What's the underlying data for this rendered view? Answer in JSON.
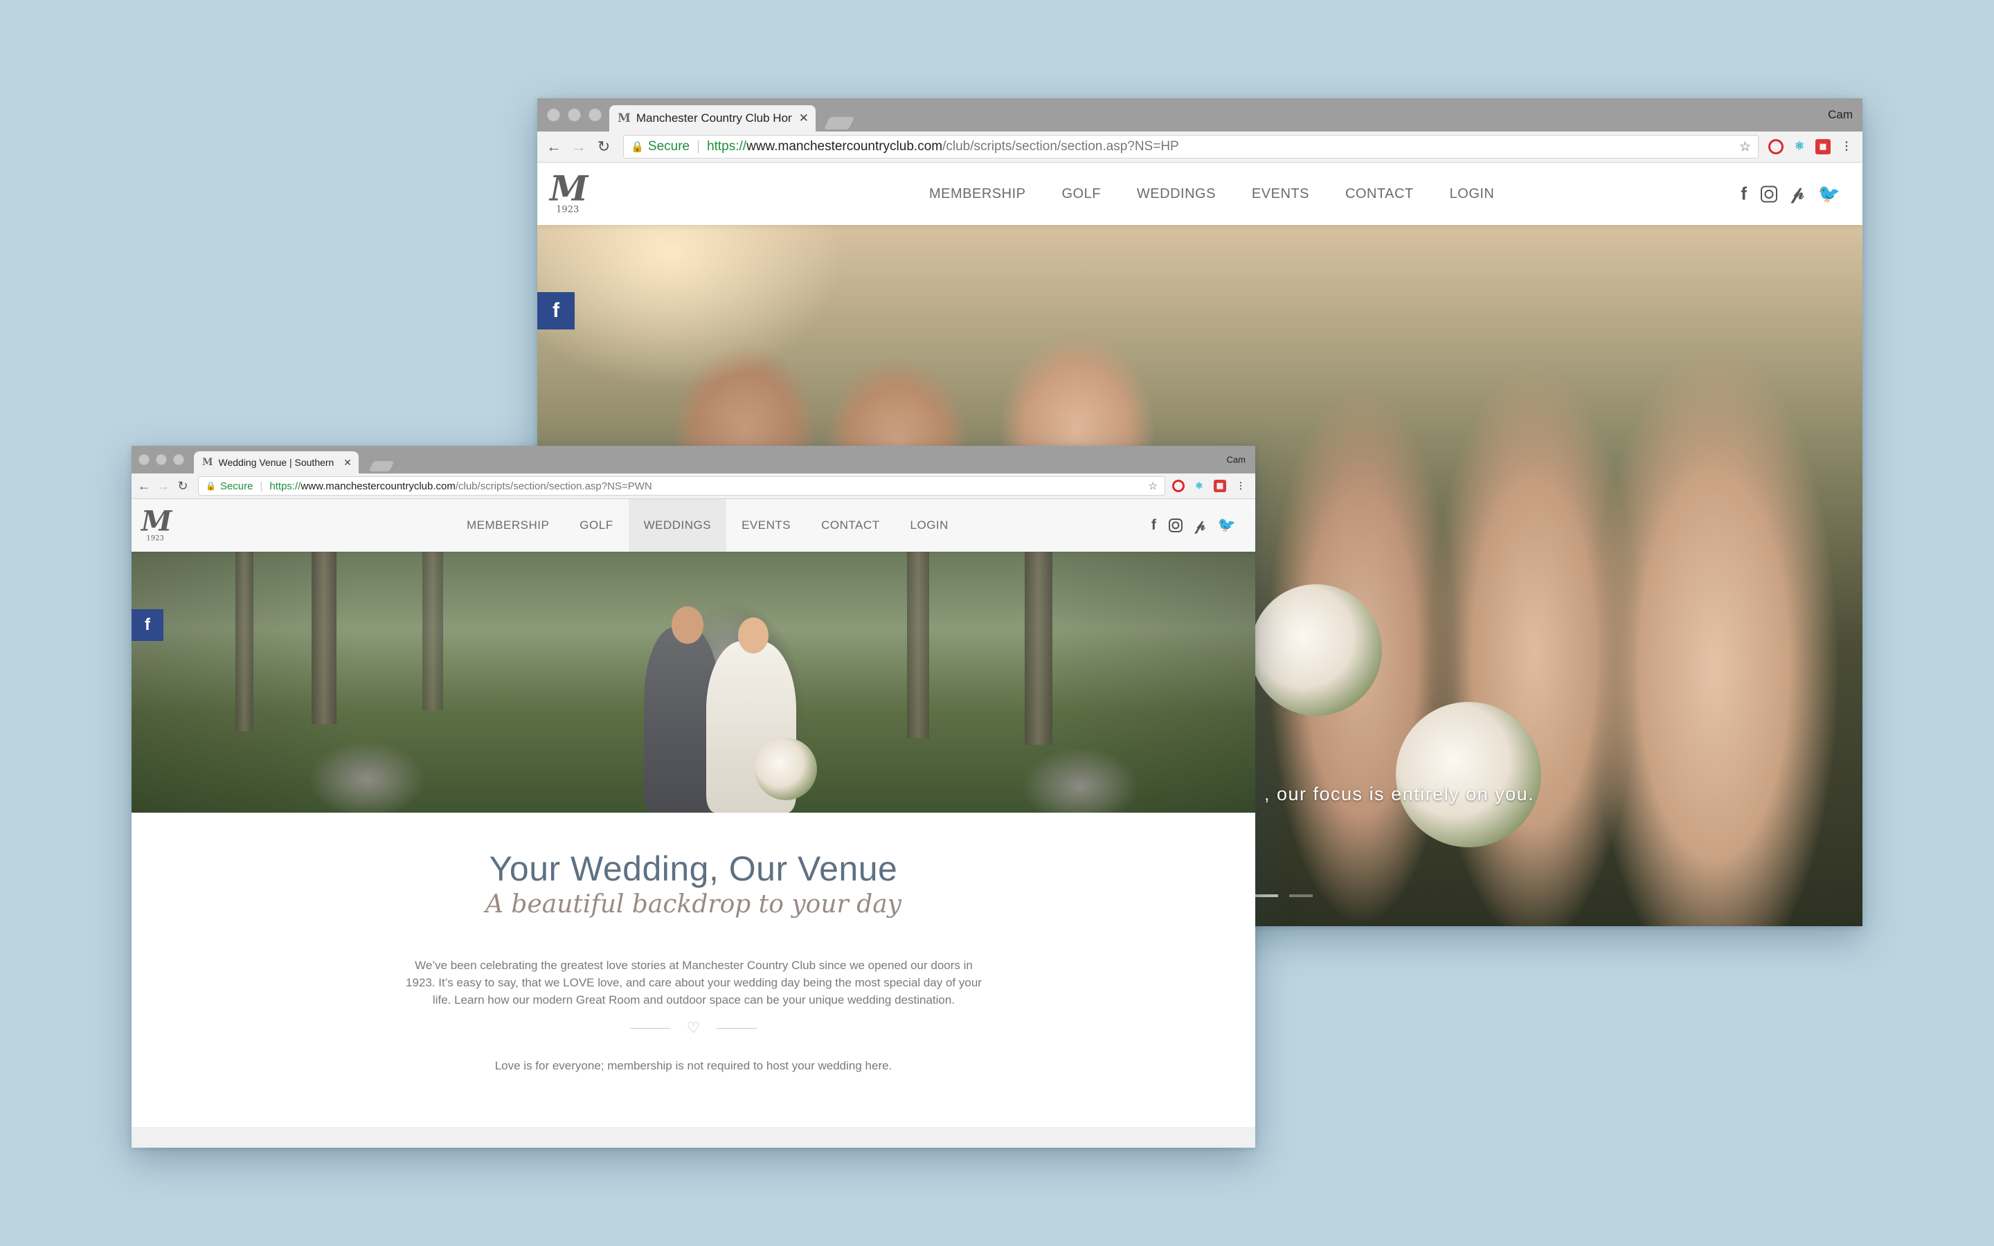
{
  "back_window": {
    "tab_title": "Manchester Country Club Hom",
    "profile": "Cam",
    "address": {
      "secure_label": "Secure",
      "url_scheme": "https://",
      "url_host": "www.manchestercountryclub.com",
      "url_path": "/club/scripts/section/section.asp?NS=HP"
    },
    "site": {
      "logo_mark": "M",
      "logo_year": "1923",
      "nav": [
        "MEMBERSHIP",
        "GOLF",
        "WEDDINGS",
        "EVENTS",
        "CONTACT",
        "LOGIN"
      ]
    },
    "hero_caption": ", our focus is entirely on you."
  },
  "front_window": {
    "tab_title": "Wedding Venue | Southern NH",
    "profile": "Cam",
    "address": {
      "secure_label": "Secure",
      "url_scheme": "https://",
      "url_host": "www.manchestercountryclub.com",
      "url_path": "/club/scripts/section/section.asp?NS=PWN"
    },
    "site": {
      "logo_mark": "M",
      "logo_year": "1923",
      "nav": [
        "MEMBERSHIP",
        "GOLF",
        "WEDDINGS",
        "EVENTS",
        "CONTACT",
        "LOGIN"
      ],
      "active_nav": "WEDDINGS"
    },
    "content": {
      "title": "Your Wedding, Our Venue",
      "subtitle": "A beautiful backdrop to your day",
      "intro": "We’ve been celebrating the greatest love stories at Manchester Country Club since we opened our doors in 1923. It’s easy to say, that we LOVE love, and care about your wedding day being the most special day of your life.  Learn how our modern Great Room and outdoor space can be your unique wedding destination.",
      "note": "Love is for everyone; membership is not required to host your wedding here."
    }
  },
  "social_icons": [
    "facebook-icon",
    "instagram-icon",
    "pinterest-icon",
    "twitter-icon"
  ],
  "colors": {
    "background": "#bcd4e0",
    "facebook_tab": "#2f4a8c",
    "secure_green": "#1f8f3c",
    "heading": "#5e7183",
    "subheading": "#9a8a84"
  }
}
